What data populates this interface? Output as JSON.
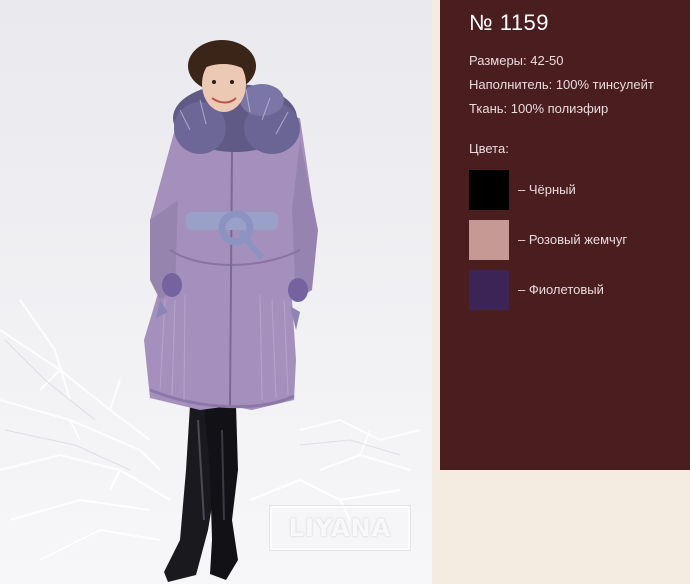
{
  "product": {
    "number": "№ 1159",
    "specs": [
      "Размеры: 42-50",
      "Наполнитель: 100% тинсулейт",
      "Ткань: 100% полиэфир"
    ],
    "colors_title": "Цвета:",
    "colors": [
      {
        "label": "– Чёрный",
        "hex": "#000000"
      },
      {
        "label": "– Розовый жемчуг",
        "hex": "#c59a94"
      },
      {
        "label": "– Фиолетовый",
        "hex": "#3c2556"
      }
    ]
  },
  "photo": {
    "watermark": "LIYANA"
  },
  "theme": {
    "panel_bg": "#4a1d1f",
    "page_bg": "#f4ece0",
    "coat_color": "#a590bd"
  }
}
